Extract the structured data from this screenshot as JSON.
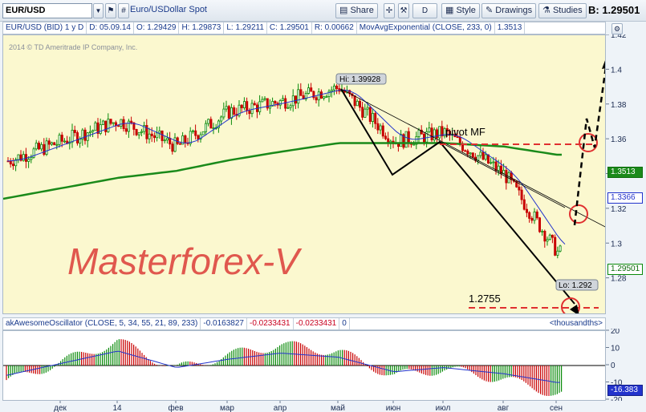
{
  "toolbar": {
    "symbol": "EUR/USD",
    "symbol_description": "Euro/USDollar Spot",
    "share_label": "Share",
    "draw_mode_label": "D",
    "style_label": "Style",
    "drawings_label": "Drawings",
    "studies_label": "Studies",
    "bid_price": "B: 1.29501"
  },
  "status": {
    "instrument": "EUR/USD (BID) 1 y D",
    "date": "D: 05.09.14",
    "open": "O: 1.29429",
    "high": "H: 1.29873",
    "low": "L: 1.29211",
    "close": "C: 1.29501",
    "range": "R: 0.00662",
    "study": "MovAvgExponential (CLOSE, 233, 0)",
    "study_value": "1.3513"
  },
  "main": {
    "copyright": "2014 © TD Ameritrade IP Company, Inc.",
    "watermark": "Masterforex-V",
    "hi_label": "Hi: 1.39928",
    "lo_label": "Lo: 1.292",
    "pivot_label": "pivot MF",
    "target_label": "1.2755",
    "price_box_ema": "1.3513",
    "price_box_ma": "1.3366",
    "price_box_last": "1.29501"
  },
  "oscillator": {
    "name": "akAwesomeOscillator (CLOSE, 5, 34, 55, 21, 89, 233)",
    "v1": "-0.0163827",
    "v2": "-0.0233431",
    "v3": "-0.0233431",
    "v4": "0",
    "units": "<thousandths>",
    "last_box": "-16.383"
  },
  "colors": {
    "up_candle": "#0a8a0a",
    "down_candle": "#c80000",
    "ema_long": "#1a8a1a",
    "ma_short": "#2233cc",
    "annotation": "#e03030",
    "background": "#fbf8cf"
  },
  "chart_data": [
    {
      "type": "line",
      "x": [
        "дек",
        "14",
        "фев",
        "мар",
        "апр",
        "май",
        "июн",
        "июл",
        "авг",
        "сен"
      ],
      "ylim": [
        1.26,
        1.42
      ],
      "yticks": [
        1.28,
        1.3,
        1.32,
        1.34,
        1.36,
        1.38,
        1.4,
        1.42
      ],
      "series": [
        {
          "name": "EUR/USD (BID)",
          "values": [
            1.359,
            1.371,
            1.356,
            1.376,
            1.382,
            1.39,
            1.359,
            1.364,
            1.34,
            1.295
          ]
        },
        {
          "name": "MovAvgExponential (CLOSE, 233, 0)",
          "values": [
            1.332,
            1.338,
            1.342,
            1.348,
            1.353,
            1.358,
            1.358,
            1.358,
            1.356,
            1.3513
          ]
        }
      ]
    },
    {
      "type": "bar",
      "x": [
        "дек",
        "14",
        "фев",
        "мар",
        "апр",
        "май",
        "июн",
        "июл",
        "авг",
        "сен"
      ],
      "ylim": [
        -20,
        20
      ],
      "yticks": [
        -20,
        -10,
        0,
        10,
        20
      ],
      "series": [
        {
          "name": "akAwesomeOscillator (CLOSE, 5, 34, 55, 21, 89, 233)",
          "values": [
            2,
            14,
            -2,
            6,
            12,
            8,
            -6,
            -2,
            -8,
            -16.383
          ]
        }
      ]
    }
  ]
}
